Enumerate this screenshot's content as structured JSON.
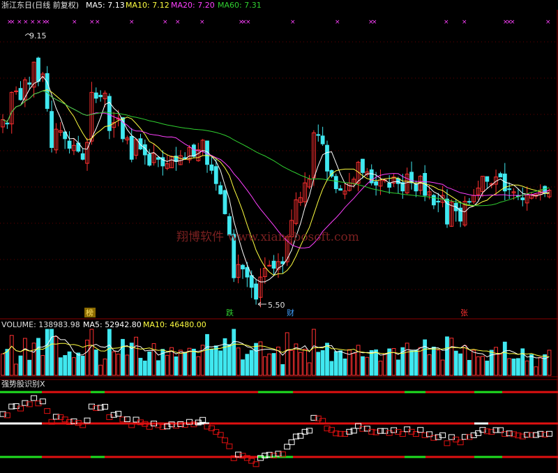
{
  "header": {
    "stock": "浙江东日(日线 前复权)",
    "ma5": "MA5: 7.13",
    "ma10": "MA10: 7.12",
    "ma20": "MA20: 7.20",
    "ma60": "MA60: 7.31"
  },
  "annotations": {
    "high": "9.15",
    "low": "5.50",
    "watermark": "翔博软件 www.xiangbosoft.com"
  },
  "event_tags": [
    "榜",
    "跌",
    "财",
    "张"
  ],
  "volume_header": {
    "volume": "VOLUME: 138983.98",
    "ma5": "MA5: 52942.80",
    "ma10": "MA10: 46480.00"
  },
  "indicator_title": "强势股识别X",
  "colors": {
    "background": "#000000",
    "up": "#ff3030",
    "down": "#40e8f0",
    "ma5": "#ffffff",
    "ma10": "#ffff40",
    "ma20": "#ff40ff",
    "ma60": "#30d030",
    "grid": "#8a0000",
    "indicator_red": "#e01010",
    "indicator_green": "#20e020",
    "watermark": "#7a2020"
  },
  "chart_data": {
    "type": "candlestick",
    "n": 124,
    "price_range": [
      5.5,
      9.15
    ],
    "close": [
      7.98,
      7.92,
      8.35,
      8.37,
      8.25,
      8.52,
      8.46,
      8.76,
      8.5,
      8.6,
      8.13,
      7.6,
      7.85,
      7.83,
      7.72,
      7.59,
      7.63,
      7.55,
      7.44,
      7.67,
      8.35,
      8.27,
      8.29,
      8.34,
      7.83,
      7.94,
      8.0,
      7.72,
      7.73,
      7.44,
      7.71,
      7.58,
      7.5,
      7.36,
      7.52,
      7.44,
      7.35,
      7.38,
      7.48,
      7.41,
      7.49,
      7.45,
      7.6,
      7.48,
      7.57,
      7.7,
      7.37,
      7.29,
      7.11,
      6.97,
      6.7,
      6.41,
      5.83,
      6.01,
      5.95,
      5.84,
      5.7,
      5.54,
      5.84,
      5.96,
      6.0,
      5.96,
      6.05,
      6.02,
      6.39,
      6.61,
      6.89,
      6.92,
      7.12,
      7.17,
      7.8,
      7.77,
      7.65,
      7.28,
      7.21,
      7.04,
      7.02,
      7.01,
      7.12,
      7.17,
      7.4,
      7.26,
      7.27,
      7.12,
      7.09,
      7.16,
      7.16,
      7.06,
      7.2,
      7.11,
      7.01,
      7.24,
      7.12,
      7.01,
      7.21,
      6.95,
      7.0,
      6.82,
      6.86,
      6.95,
      6.56,
      6.86,
      6.74,
      6.6,
      6.87,
      6.86,
      6.95,
      7.05,
      7.21,
      7.14,
      7.11,
      7.2,
      7.2,
      7.01,
      7.04,
      7.0,
      6.94,
      6.89,
      6.97,
      6.96,
      6.96,
      7.02,
      6.98,
      7.02
    ],
    "series": [
      {
        "name": "MA5"
      },
      {
        "name": "MA10"
      },
      {
        "name": "MA20"
      },
      {
        "name": "MA60"
      },
      {
        "name": "VOLUME"
      },
      {
        "name": "强势股识别X"
      }
    ]
  }
}
